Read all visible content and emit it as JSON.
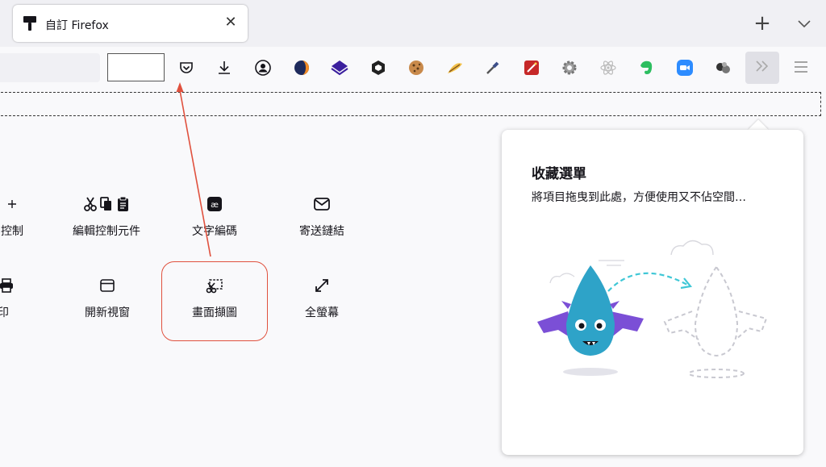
{
  "tab": {
    "title": "自訂 Firefox",
    "close": "✕"
  },
  "tabstrip": {
    "new_tab": "+"
  },
  "toolbar": {
    "icons": [
      "pocket-icon",
      "download-icon",
      "account-icon",
      "extension-icon-1",
      "extension-icon-2",
      "extension-icon-3",
      "cookie-icon",
      "extension-icon-5",
      "eyedropper-icon",
      "magic-wand-icon",
      "gear-extension-icon",
      "atom-icon",
      "evernote-icon",
      "zoom-icon",
      "balls-icon"
    ]
  },
  "palette": {
    "row1": [
      {
        "label": "控制",
        "icon": "plus-icon"
      },
      {
        "label": "編輯控制元件",
        "icon": "cut-copy-paste-icon"
      },
      {
        "label": "文字編碼",
        "icon": "text-encoding-icon"
      },
      {
        "label": "寄送鏈結",
        "icon": "mail-icon"
      }
    ],
    "row2": [
      {
        "label": "印",
        "icon": "print-icon"
      },
      {
        "label": "開新視窗",
        "icon": "new-window-icon"
      },
      {
        "label": "畫面擷圖",
        "icon": "screenshot-icon"
      },
      {
        "label": "全螢幕",
        "icon": "fullscreen-icon"
      }
    ]
  },
  "overflow_panel": {
    "title": "收藏選單",
    "description": "將項目拖曳到此處，方便使用又不佔空間…"
  },
  "colors": {
    "highlight": "#e0513e",
    "arrow": "#e0513e",
    "dragon": "#2ea3c8",
    "wings": "#7b4fd6"
  }
}
